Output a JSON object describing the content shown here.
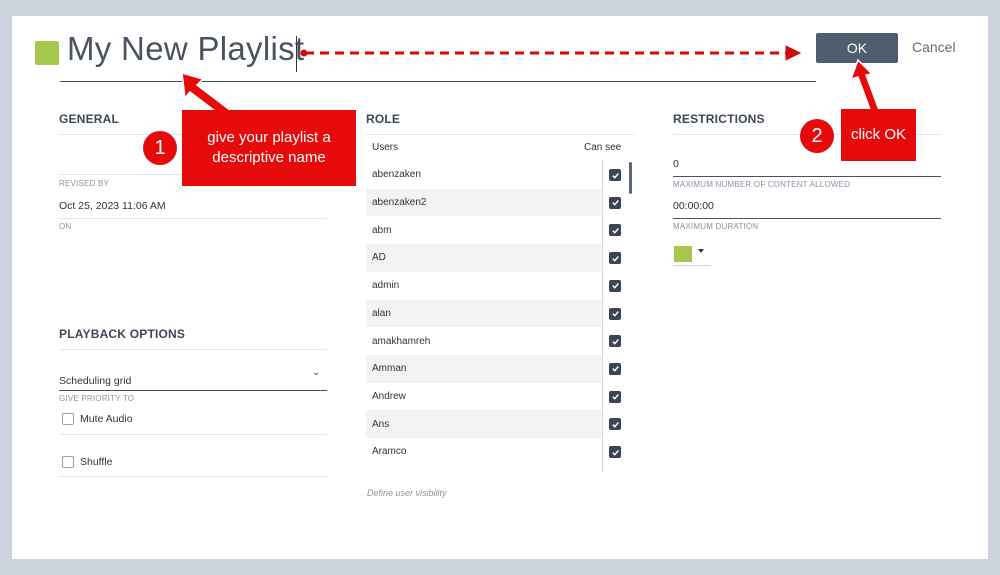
{
  "header": {
    "playlist_name": "My New Playlist",
    "ok_label": "OK",
    "cancel_label": "Cancel",
    "swatch_color": "#a6c64c"
  },
  "general": {
    "title": "GENERAL",
    "revised_by_label": "REVISED BY",
    "revised_on_value": "Oct 25, 2023 11:06 AM",
    "on_label": "ON"
  },
  "playback": {
    "title": "PLAYBACK OPTIONS",
    "priority_value": "Scheduling grid",
    "priority_label": "GIVE PRIORITY TO",
    "mute_audio_label": "Mute Audio",
    "shuffle_label": "Shuffle"
  },
  "role": {
    "title": "ROLE",
    "users_header": "Users",
    "can_see_header": "Can see",
    "users": [
      "abenzaken",
      "abenzaken2",
      "abm",
      "AD",
      "admin",
      "alan",
      "amakhamreh",
      "Amman",
      "Andrew",
      "Ans",
      "Aramco"
    ],
    "hint": "Define user visibility"
  },
  "restrictions": {
    "title": "RESTRICTIONS",
    "max_content_value": "0",
    "max_content_label": "MAXIMUM NUMBER OF CONTENT ALLOWED",
    "max_duration_value": "00:00:00",
    "max_duration_label": "MAXIMUM DURATION",
    "color_value": "#a6c64c"
  },
  "annotations": {
    "step1_number": "1",
    "step1_text": "give your playlist a descriptive name",
    "step2_number": "2",
    "step2_text": "click OK",
    "color": "#e60b0b"
  }
}
